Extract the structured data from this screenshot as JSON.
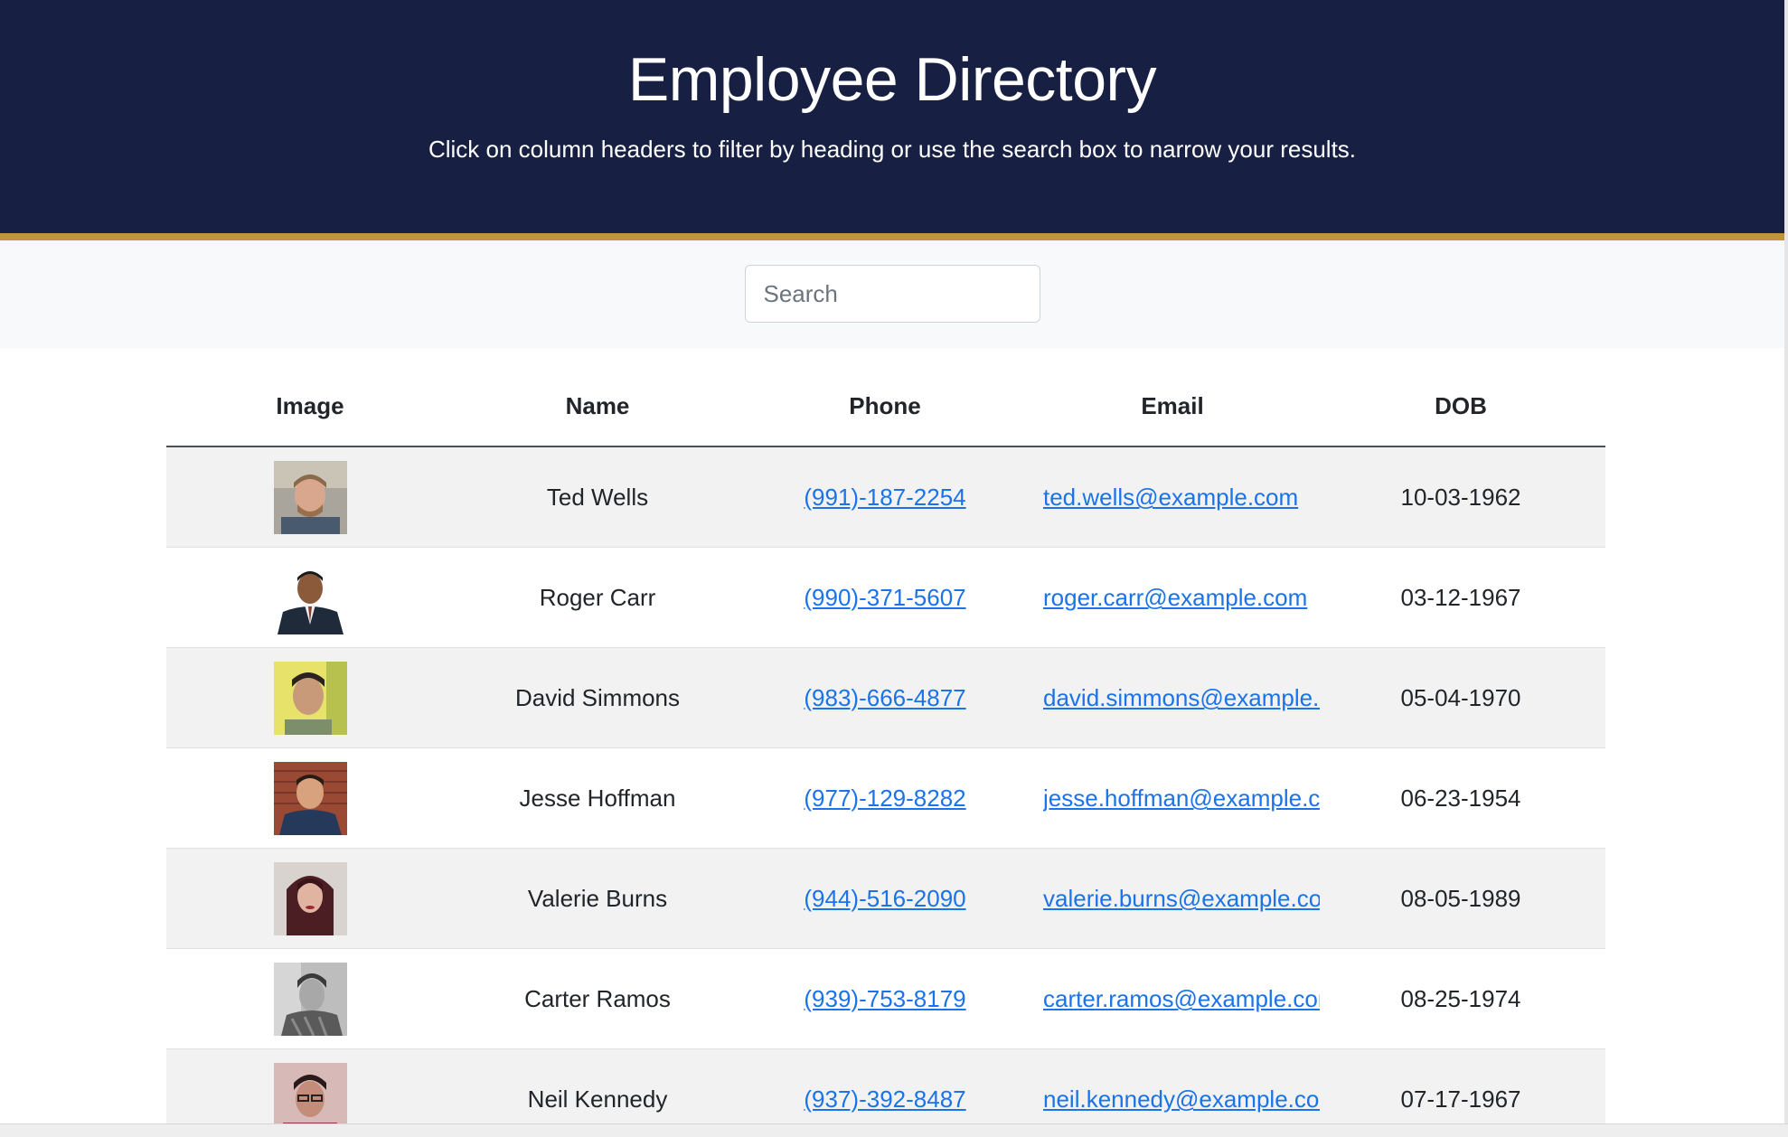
{
  "header": {
    "title": "Employee Directory",
    "subtitle": "Click on column headers to filter by heading or use the search box to narrow your results."
  },
  "search": {
    "placeholder": "Search",
    "value": ""
  },
  "colors": {
    "header_bg": "#172043",
    "header_accent": "#c4913f",
    "link": "#1a73e8"
  },
  "table": {
    "columns": [
      "Image",
      "Name",
      "Phone",
      "Email",
      "DOB"
    ],
    "rows": [
      {
        "image": "avatar-photo",
        "name": "Ted Wells",
        "phone": "(991)-187-2254",
        "email": "ted.wells@example.com",
        "dob": "10-03-1962"
      },
      {
        "image": "avatar-photo",
        "name": "Roger Carr",
        "phone": "(990)-371-5607",
        "email": "roger.carr@example.com",
        "dob": "03-12-1967"
      },
      {
        "image": "avatar-photo",
        "name": "David Simmons",
        "phone": "(983)-666-4877",
        "email": "david.simmons@example.com",
        "dob": "05-04-1970"
      },
      {
        "image": "avatar-photo",
        "name": "Jesse Hoffman",
        "phone": "(977)-129-8282",
        "email": "jesse.hoffman@example.com",
        "dob": "06-23-1954"
      },
      {
        "image": "avatar-photo",
        "name": "Valerie Burns",
        "phone": "(944)-516-2090",
        "email": "valerie.burns@example.com",
        "dob": "08-05-1989"
      },
      {
        "image": "avatar-photo",
        "name": "Carter Ramos",
        "phone": "(939)-753-8179",
        "email": "carter.ramos@example.com",
        "dob": "08-25-1974"
      },
      {
        "image": "avatar-photo",
        "name": "Neil Kennedy",
        "phone": "(937)-392-8487",
        "email": "neil.kennedy@example.com",
        "dob": "07-17-1967"
      }
    ]
  }
}
